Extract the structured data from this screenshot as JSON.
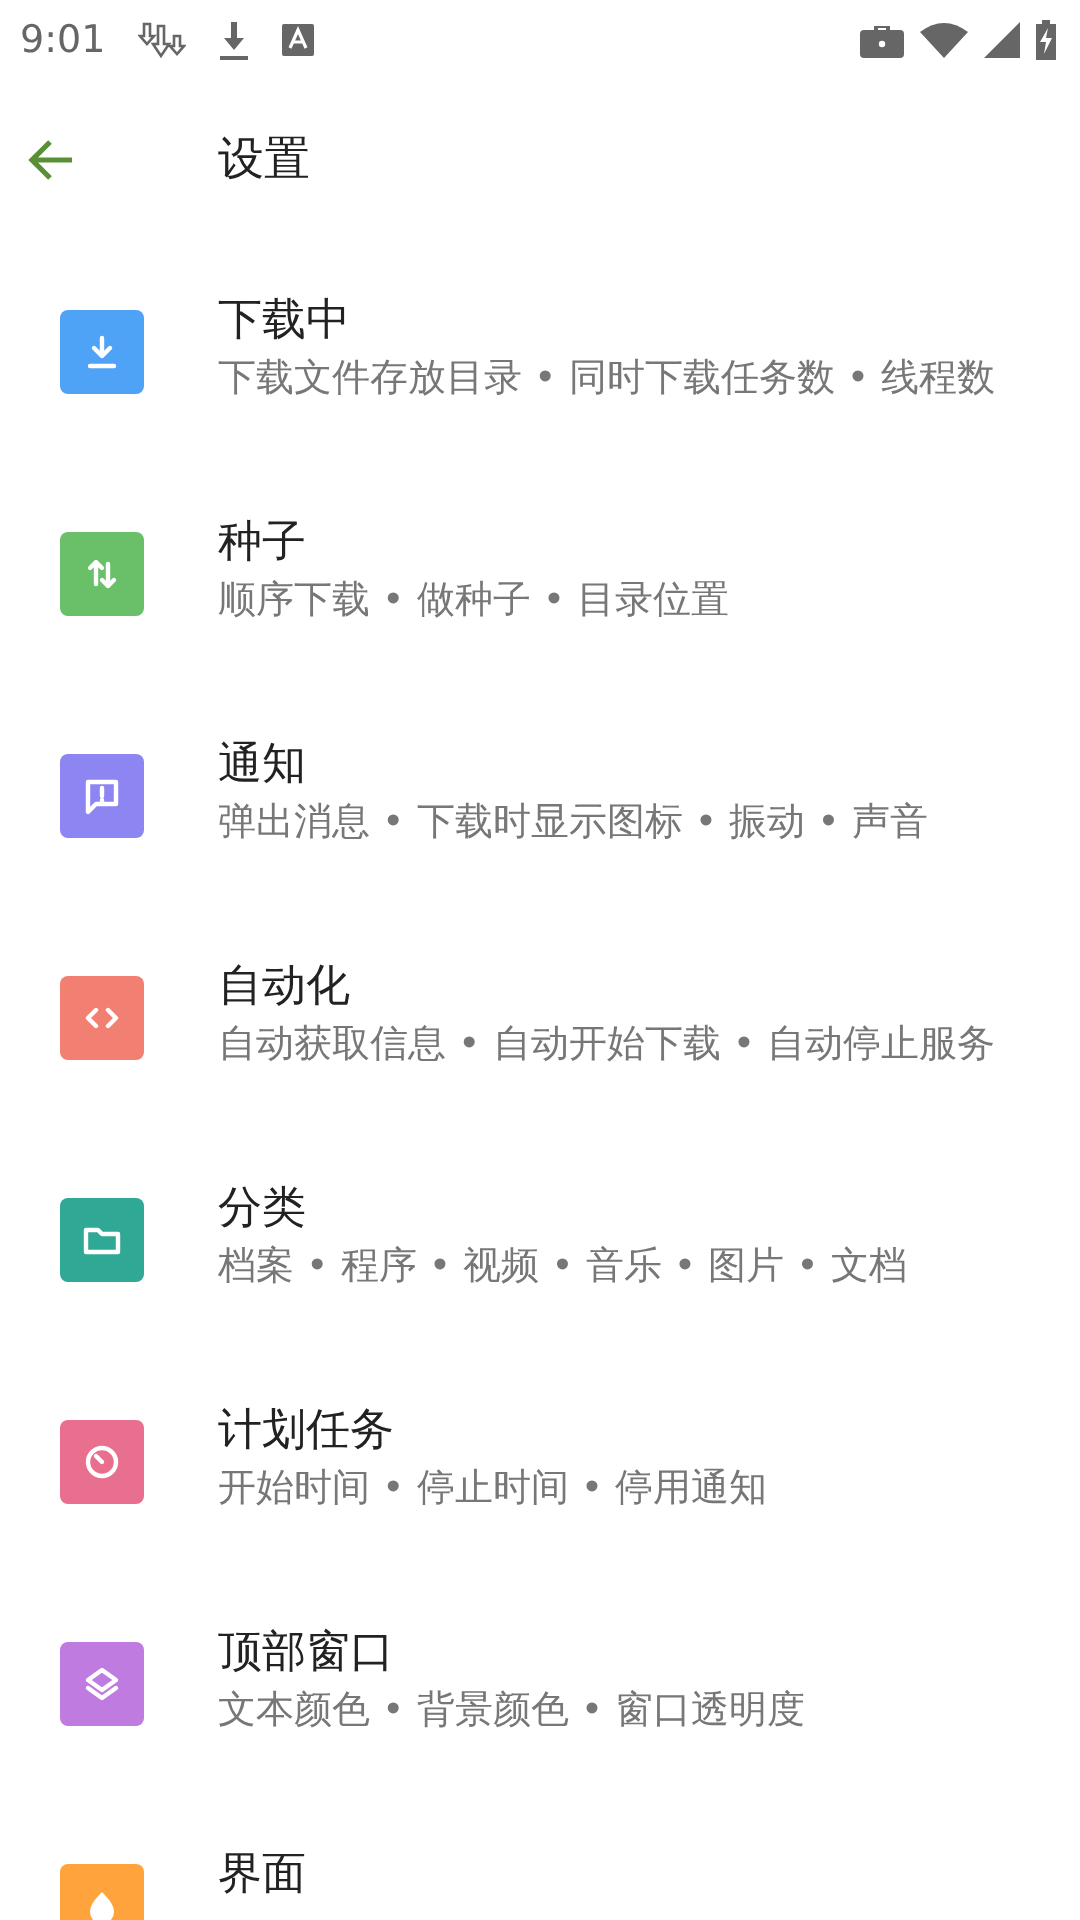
{
  "status_bar": {
    "time": "9:01"
  },
  "toolbar": {
    "title": "设置"
  },
  "settings": [
    {
      "kind": "download",
      "color": "#4fa3f7",
      "title": "下载中",
      "summary": "下载文件存放目录 • 同时下载任务数 • 线程数"
    },
    {
      "kind": "swap",
      "color": "#6abf69",
      "title": "种子",
      "summary": "顺序下载 • 做种子 • 目录位置"
    },
    {
      "kind": "message",
      "color": "#8c85f2",
      "title": "通知",
      "summary": "弹出消息 • 下载时显示图标 • 振动 • 声音"
    },
    {
      "kind": "code",
      "color": "#f28072",
      "title": "自动化",
      "summary": "自动获取信息 • 自动开始下载 • 自动停止服务"
    },
    {
      "kind": "folder",
      "color": "#2fa895",
      "title": "分类",
      "summary": "档案 • 程序 • 视频 • 音乐 • 图片 • 文档"
    },
    {
      "kind": "timer",
      "color": "#e96f8f",
      "title": "计划任务",
      "summary": "开始时间 • 停止时间 • 停用通知"
    },
    {
      "kind": "layers",
      "color": "#bf7be0",
      "title": "顶部窗口",
      "summary": "文本颜色 • 背景颜色 • 窗口透明度"
    },
    {
      "kind": "palette",
      "color": "#ffa43d",
      "title": "界面"
    }
  ]
}
